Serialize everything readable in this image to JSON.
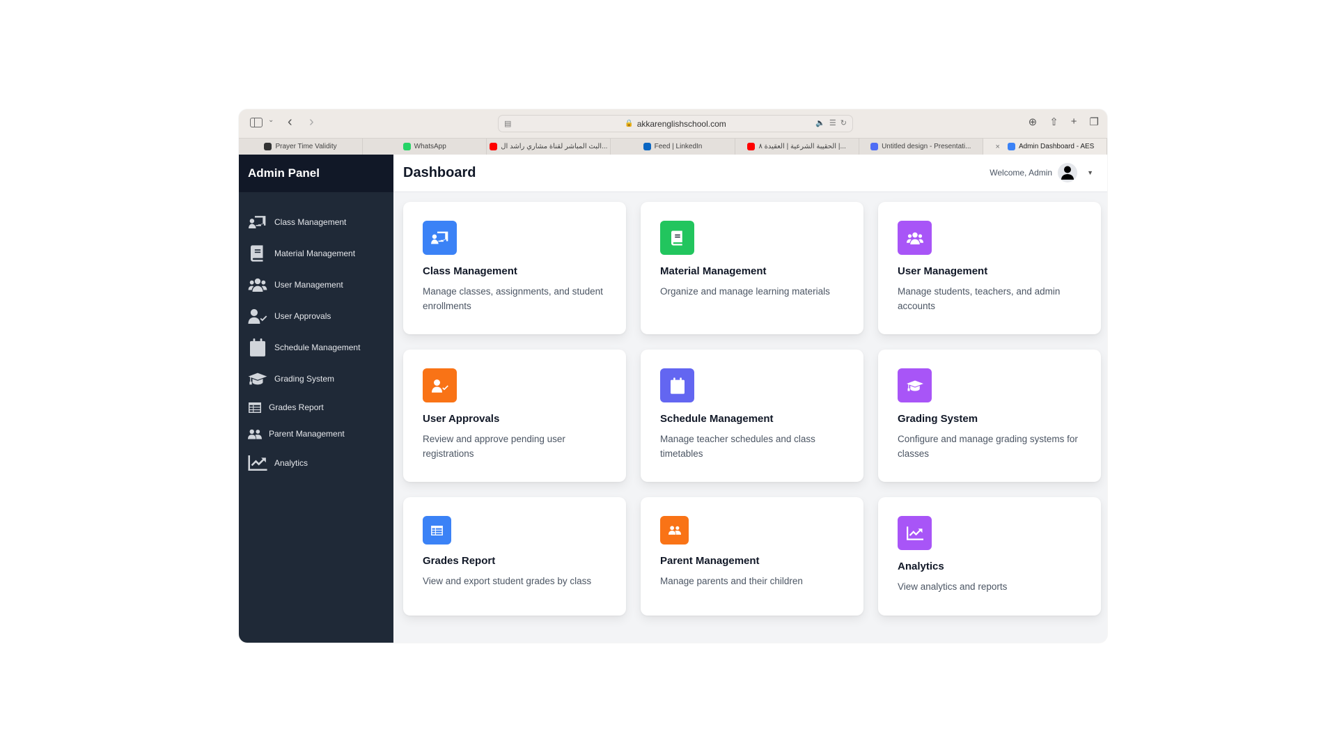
{
  "browser": {
    "url": "akkarenglishschool.com",
    "tabs": [
      {
        "label": "Prayer Time Validity",
        "icon": "openai-icon",
        "color": "#333333",
        "active": false
      },
      {
        "label": "WhatsApp",
        "icon": "whatsapp-icon",
        "color": "#25d366",
        "active": false
      },
      {
        "label": "البث المباشر لقناة مشاري راشد ال...",
        "icon": "youtube-icon",
        "color": "#ff0000",
        "active": false
      },
      {
        "label": "Feed | LinkedIn",
        "icon": "linkedin-icon",
        "color": "#0a66c2",
        "active": false
      },
      {
        "label": "الحقيبة الشرعية | العقيدة ٨ |...",
        "icon": "youtube-icon",
        "color": "#ff0000",
        "active": false
      },
      {
        "label": "Untitled design - Presentati...",
        "icon": "canva-icon",
        "color": "#4f6df5",
        "active": false
      },
      {
        "label": "Admin Dashboard - AES",
        "icon": "school-logo-icon",
        "color": "#3b82f6",
        "active": true
      }
    ]
  },
  "sidebar": {
    "title": "Admin Panel",
    "items": [
      {
        "label": "Class Management",
        "icon": "chalkboard-teacher-icon"
      },
      {
        "label": "Material Management",
        "icon": "book-icon"
      },
      {
        "label": "User Management",
        "icon": "users-icon"
      },
      {
        "label": "User Approvals",
        "icon": "user-check-icon"
      },
      {
        "label": "Schedule Management",
        "icon": "calendar-icon"
      },
      {
        "label": "Grading System",
        "icon": "graduation-cap-icon"
      },
      {
        "label": "Grades Report",
        "icon": "table-icon"
      },
      {
        "label": "Parent Management",
        "icon": "user-friends-icon"
      },
      {
        "label": "Analytics",
        "icon": "chart-line-icon"
      }
    ]
  },
  "header": {
    "title": "Dashboard",
    "welcome": "Welcome, Admin"
  },
  "cards": [
    {
      "title": "Class Management",
      "description": "Manage classes, assignments, and student enrollments",
      "icon": "chalkboard-teacher-icon",
      "color": "#3b82f6"
    },
    {
      "title": "Material Management",
      "description": "Organize and manage learning materials",
      "icon": "book-icon",
      "color": "#22c55e"
    },
    {
      "title": "User Management",
      "description": "Manage students, teachers, and admin accounts",
      "icon": "users-icon",
      "color": "#a855f7"
    },
    {
      "title": "User Approvals",
      "description": "Review and approve pending user registrations",
      "icon": "user-check-icon",
      "color": "#f97316"
    },
    {
      "title": "Schedule Management",
      "description": "Manage teacher schedules and class timetables",
      "icon": "calendar-icon",
      "color": "#6366f1"
    },
    {
      "title": "Grading System",
      "description": "Configure and manage grading systems for classes",
      "icon": "graduation-cap-icon",
      "color": "#a855f7"
    },
    {
      "title": "Grades Report",
      "description": "View and export student grades by class",
      "icon": "table-icon",
      "color": "#3b82f6"
    },
    {
      "title": "Parent Management",
      "description": "Manage parents and their children",
      "icon": "user-friends-icon",
      "color": "#f97316"
    },
    {
      "title": "Analytics",
      "description": "View analytics and reports",
      "icon": "chart-line-icon",
      "color": "#a855f7"
    }
  ]
}
